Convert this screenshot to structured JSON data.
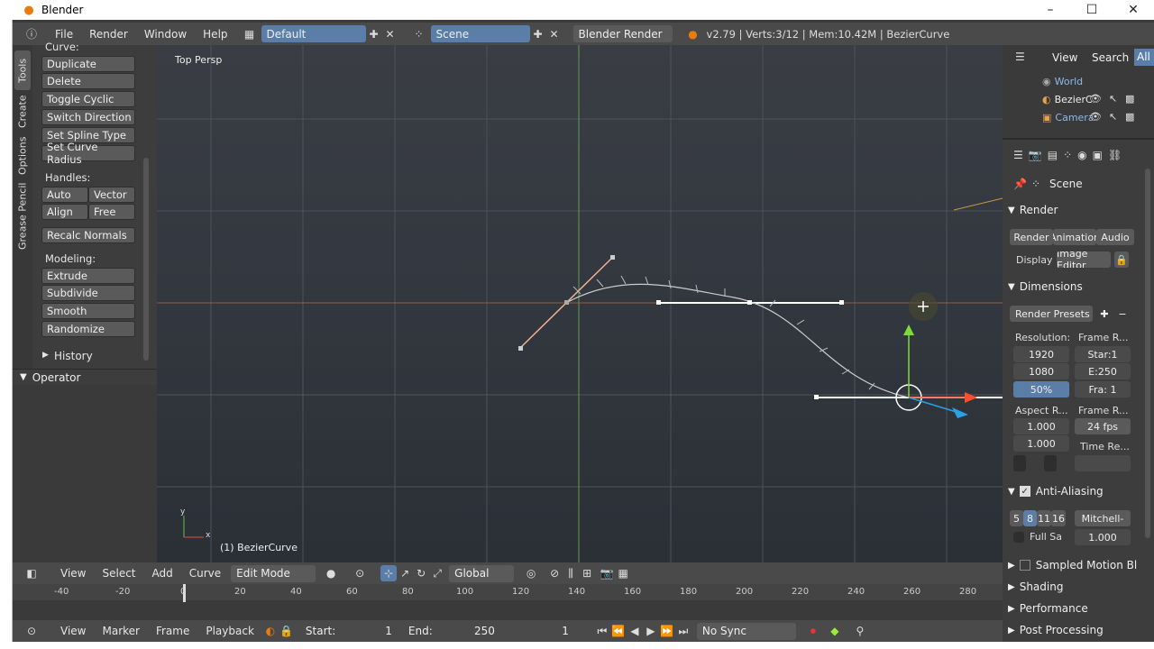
{
  "window": {
    "title": "Blender",
    "minimize": "–",
    "maximize": "☐",
    "close": "✕"
  },
  "topbar": {
    "menus": [
      "File",
      "Render",
      "Window",
      "Help"
    ],
    "layout": "Default",
    "scene": "Scene",
    "engine": "Blender Render",
    "stats": "v2.79 | Verts:3/12 | Mem:10.42M | BezierCurve"
  },
  "toolshelf": {
    "tabs": [
      "Tools",
      "Create",
      "Options",
      "Grease Pencil"
    ],
    "curve_header": "Curve:",
    "curve_buttons": [
      "Duplicate",
      "Delete",
      "Toggle Cyclic",
      "Switch Direction",
      "Set Spline Type",
      "Set Curve Radius"
    ],
    "handles_label": "Handles:",
    "handles": [
      "Auto",
      "Vector",
      "Align",
      "Free"
    ],
    "recalc": "Recalc Normals",
    "modeling_label": "Modeling:",
    "modeling": [
      "Extrude",
      "Subdivide",
      "Smooth",
      "Randomize"
    ],
    "history": "History",
    "operator": "Operator"
  },
  "viewport": {
    "view_label": "Top Persp",
    "object_label": "(1) BezierCurve",
    "axis_y": "y",
    "axis_x": "x"
  },
  "outliner": {
    "menus": [
      "View",
      "Search",
      "All"
    ],
    "items": [
      "World",
      "BezierCurve",
      "Camera"
    ]
  },
  "properties": {
    "context": "Scene",
    "render_header": "Render",
    "render_buttons": [
      "Render",
      "Animation",
      "Audio"
    ],
    "display_label": "Display",
    "display_value": "Image Editor",
    "dimensions_header": "Dimensions",
    "presets": "Render Presets",
    "resolution_label": "Resolution:",
    "res_x": "1920",
    "res_y": "1080",
    "res_pct": "50%",
    "frame_range_label": "Frame R...",
    "frame_start": "Star:1",
    "frame_end": "E:250",
    "frame_step": "Fra: 1",
    "aspect_label": "Aspect R...",
    "aspect_x": "1.000",
    "aspect_y": "1.000",
    "frame_rate_label": "Frame R...",
    "fps": "24 fps",
    "time_remap": "Time Re...",
    "aa_header": "Anti-Aliasing",
    "aa_samples": [
      "5",
      "8",
      "11",
      "16"
    ],
    "aa_filter": "Mitchell-",
    "full_sample": "Full Sa",
    "aa_size": "1.000",
    "collapsed": [
      "Sampled Motion Bl",
      "Shading",
      "Performance",
      "Post Processing"
    ]
  },
  "view3d_header": {
    "menus": [
      "View",
      "Select",
      "Add",
      "Curve"
    ],
    "mode": "Edit Mode",
    "orientation": "Global"
  },
  "timeline": {
    "ticks": [
      "-40",
      "-20",
      "0",
      "20",
      "40",
      "60",
      "80",
      "100",
      "120",
      "140",
      "160",
      "180",
      "200",
      "220",
      "240",
      "260",
      "280"
    ],
    "current_frame": 1
  },
  "timeline_header": {
    "menus": [
      "View",
      "Marker",
      "Frame",
      "Playback"
    ],
    "start_label": "Start:",
    "start": "1",
    "end_label": "End:",
    "end": "250",
    "current": "1",
    "sync": "No Sync"
  }
}
